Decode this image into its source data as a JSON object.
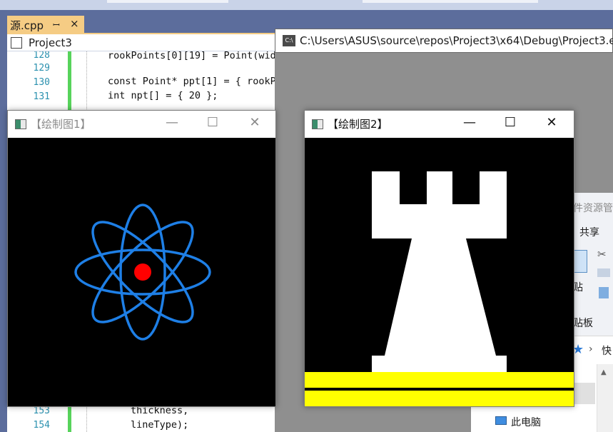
{
  "editor": {
    "tab_label": "源.cpp",
    "tab_pin": "ꟷ",
    "tab_close": "×",
    "project_label": "Project3",
    "lines": [
      {
        "num": "128",
        "code": "rookPoints[0][19] = Point(wid"
      },
      {
        "num": "129",
        "code": ""
      },
      {
        "num": "130",
        "code": "const Point* ppt[1] = { rookPo"
      },
      {
        "num": "131",
        "code": "int npt[] = { 20 };"
      },
      {
        "num": "153",
        "code": "thickness,"
      },
      {
        "num": "154",
        "code": "lineType);"
      }
    ]
  },
  "console": {
    "path": "C:\\Users\\ASUS\\source\\repos\\Project3\\x64\\Debug\\Project3.e",
    "icon_text": "C:\\"
  },
  "explorer": {
    "title": "件资源管",
    "share": "共享",
    "paste": "贴",
    "clipboard": "贴板",
    "quick": "快",
    "this_pc": "此电脑"
  },
  "window1": {
    "title": "【绘制图1】",
    "min": "—",
    "max": "☐",
    "close": "✕"
  },
  "window2": {
    "title": "【绘制图2】",
    "min": "—",
    "max": "☐",
    "close": "✕"
  },
  "colors": {
    "atom_orbit": "#1e7fe6",
    "atom_nucleus": "#ff0000",
    "rook": "#ffffff",
    "stripes": "#ffff00",
    "canvas_bg": "#000000"
  },
  "icons": {
    "tab_pin": "pin-icon",
    "tab_close": "close-icon",
    "project": "project-icon",
    "console": "console-icon",
    "window": "opencv-window-icon",
    "explorer_star": "star-icon",
    "this_pc": "computer-icon"
  }
}
